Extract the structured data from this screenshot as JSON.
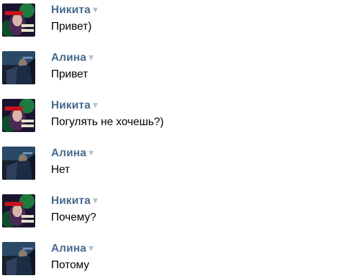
{
  "messages": [
    {
      "author": "Никита",
      "text": "Привет)",
      "avatar": "nikita-avatar"
    },
    {
      "author": "Алина",
      "text": "Привет",
      "avatar": "alina-avatar"
    },
    {
      "author": "Никита",
      "text": "Погулять не хочешь?)",
      "avatar": "nikita-avatar"
    },
    {
      "author": "Алина",
      "text": "Нет",
      "avatar": "alina-avatar"
    },
    {
      "author": "Никита",
      "text": "Почему?",
      "avatar": "nikita-avatar"
    },
    {
      "author": "Алина",
      "text": "Потому",
      "avatar": "alina-avatar"
    }
  ],
  "ui": {
    "dropdown_glyph": "▼",
    "colors": {
      "author_name": "#45688e",
      "message_text": "#000000",
      "dropdown_caret": "#b7bec6",
      "background": "#ffffff"
    }
  }
}
